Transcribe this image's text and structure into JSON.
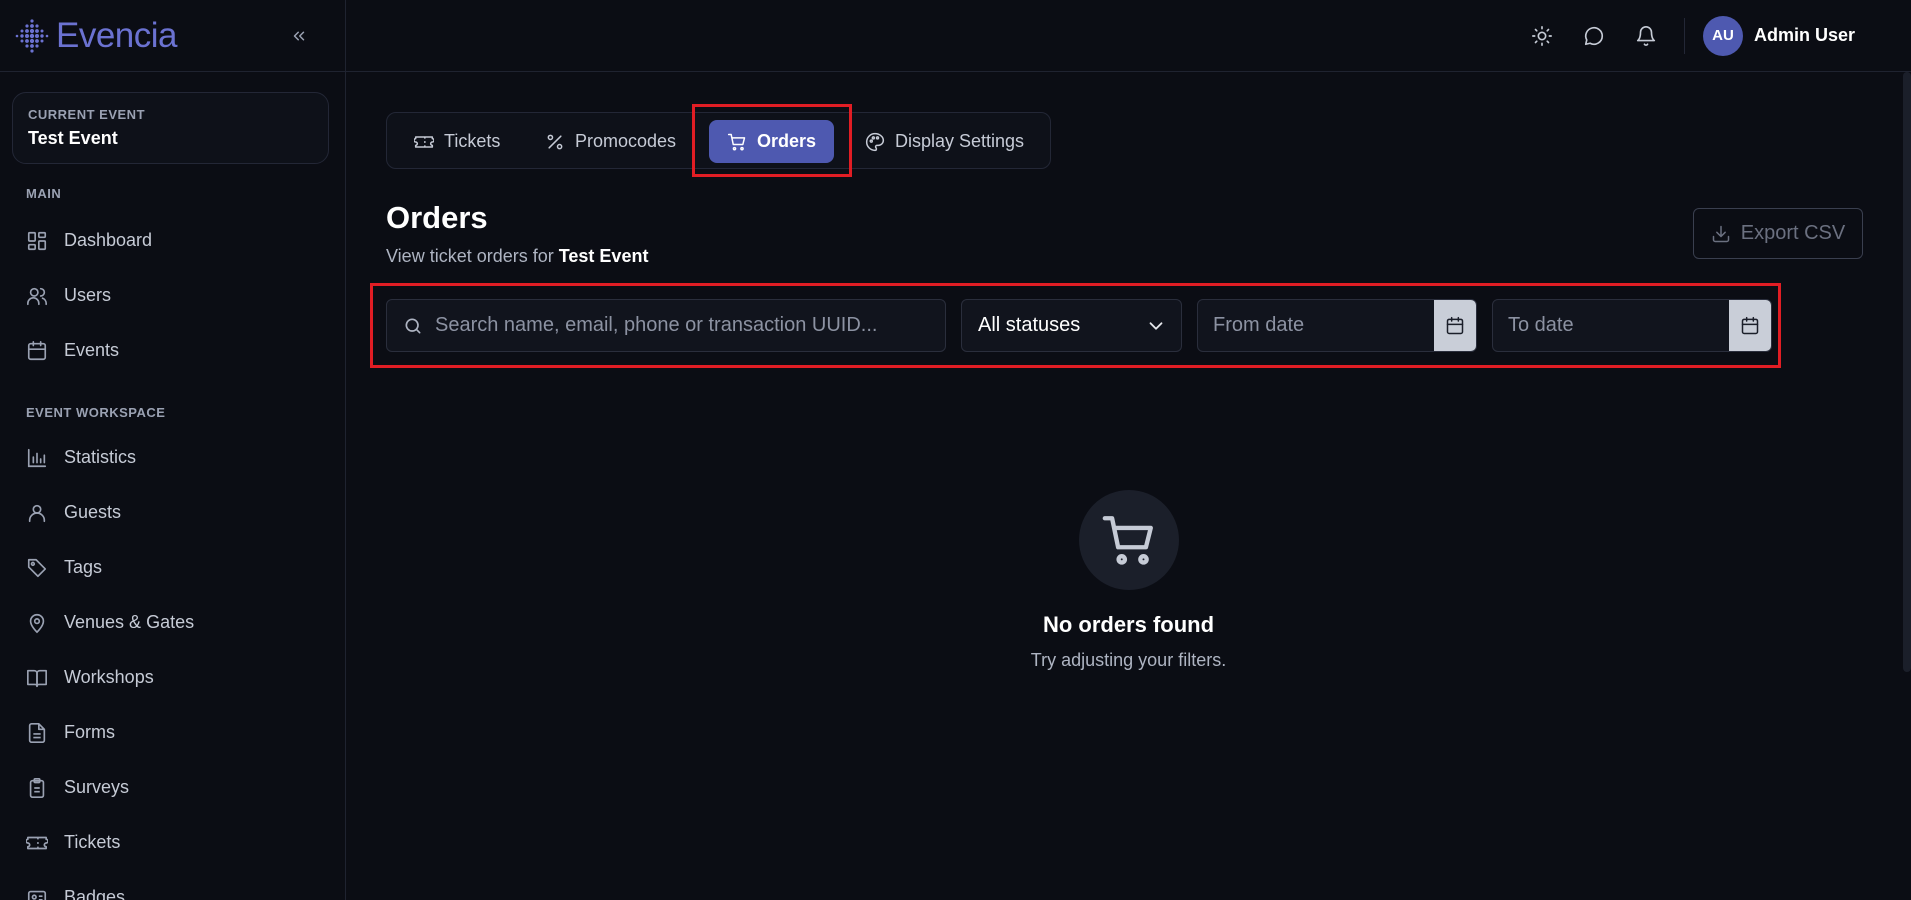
{
  "brand": {
    "name": "Evencia",
    "accent": "#4e59b0",
    "logo_color": "#6b72d1"
  },
  "sidebar": {
    "collapse_icon": "chevrons-left-icon",
    "current_event": {
      "label": "CURRENT EVENT",
      "name": "Test Event"
    },
    "sections": [
      {
        "label": "MAIN",
        "items": [
          {
            "label": "Dashboard",
            "icon": "dashboard-icon"
          },
          {
            "label": "Users",
            "icon": "users-icon"
          },
          {
            "label": "Events",
            "icon": "calendar-icon"
          }
        ]
      },
      {
        "label": "EVENT WORKSPACE",
        "items": [
          {
            "label": "Statistics",
            "icon": "bar-chart-icon"
          },
          {
            "label": "Guests",
            "icon": "user-icon"
          },
          {
            "label": "Tags",
            "icon": "tag-icon"
          },
          {
            "label": "Venues & Gates",
            "icon": "map-pin-icon"
          },
          {
            "label": "Workshops",
            "icon": "book-icon"
          },
          {
            "label": "Forms",
            "icon": "file-icon"
          },
          {
            "label": "Surveys",
            "icon": "clipboard-icon"
          },
          {
            "label": "Tickets",
            "icon": "ticket-icon"
          },
          {
            "label": "Badges",
            "icon": "badge-icon"
          }
        ]
      }
    ]
  },
  "topbar": {
    "icons": [
      "sun-icon",
      "message-icon",
      "bell-icon"
    ],
    "user": {
      "initials": "AU",
      "name": "Admin User"
    }
  },
  "tabs": [
    {
      "label": "Tickets",
      "icon": "ticket-icon",
      "active": false
    },
    {
      "label": "Promocodes",
      "icon": "percent-icon",
      "active": false
    },
    {
      "label": "Orders",
      "icon": "cart-icon",
      "active": true
    },
    {
      "label": "Display Settings",
      "icon": "palette-icon",
      "active": false
    }
  ],
  "page": {
    "title": "Orders",
    "subtitle_prefix": "View ticket orders for",
    "subtitle_event": "Test Event",
    "export_label": "Export CSV"
  },
  "filters": {
    "search_placeholder": "Search name, email, phone or transaction UUID...",
    "status_value": "All statuses",
    "from_date_placeholder": "From date",
    "to_date_placeholder": "To date"
  },
  "empty_state": {
    "title": "No orders found",
    "subtitle": "Try adjusting your filters."
  },
  "highlight_color": "#e11d24"
}
